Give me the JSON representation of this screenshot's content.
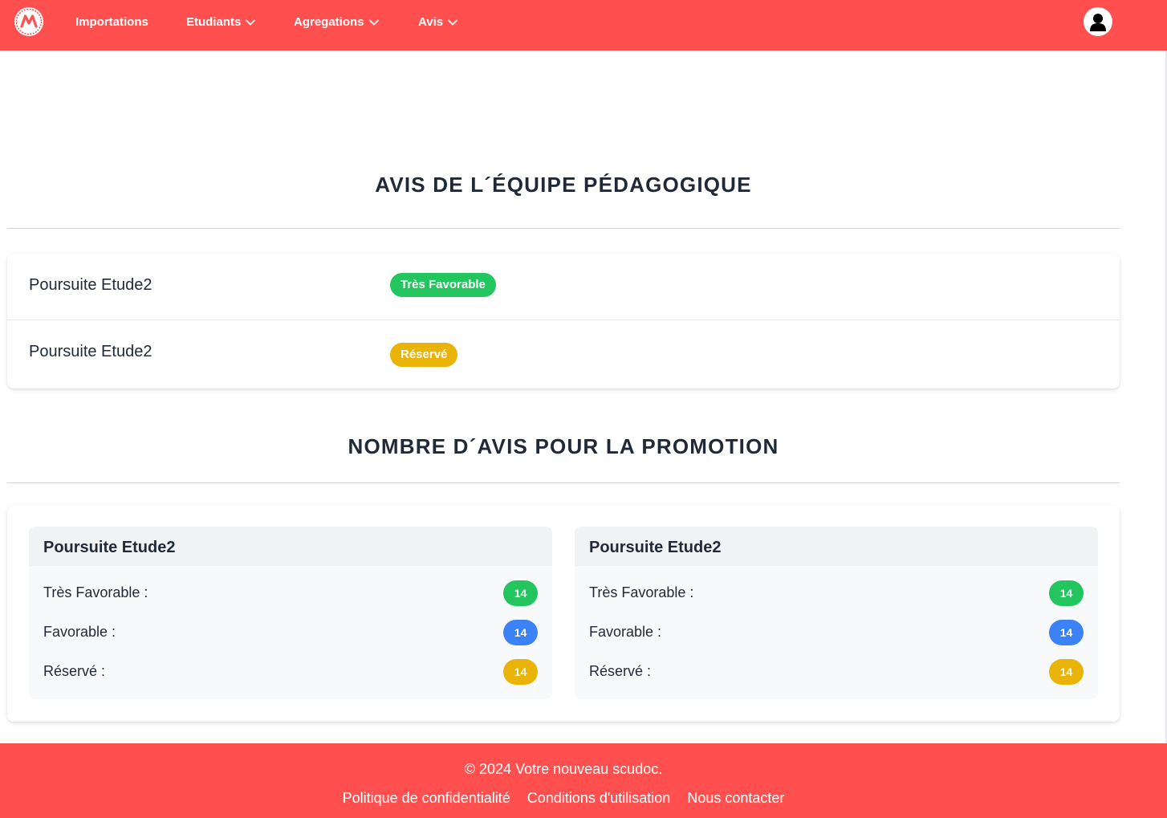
{
  "navbar": {
    "brand_color": "#ff4f4f",
    "logo_icon": "brand-logo-icon",
    "items": [
      {
        "label": "Importations",
        "has_dropdown": false
      },
      {
        "label": "Etudiants",
        "has_dropdown": true
      },
      {
        "label": "Agregations",
        "has_dropdown": true
      },
      {
        "label": "Avis",
        "has_dropdown": true
      }
    ],
    "avatar_icon": "user-avatar-icon"
  },
  "team_section": {
    "title": "AVIS DE L´ÉQUIPE PÉDAGOGIQUE",
    "rows": [
      {
        "label": "Poursuite Etude2",
        "status": "Très Favorable",
        "status_color": "#22c55e"
      },
      {
        "label": "Poursuite Etude2",
        "status": "Réservé",
        "status_color": "#eab308"
      }
    ]
  },
  "promo_section": {
    "title": "NOMBRE D´AVIS POUR LA PROMOTION",
    "panels": [
      {
        "title": "Poursuite Etude2",
        "counts": [
          {
            "label": "Très Favorable :",
            "value": "14",
            "color": "#22c55e"
          },
          {
            "label": "Favorable :",
            "value": "14",
            "color": "#3b82f6"
          },
          {
            "label": "Réservé :",
            "value": "14",
            "color": "#eab308"
          }
        ]
      },
      {
        "title": "Poursuite Etude2",
        "counts": [
          {
            "label": "Très Favorable :",
            "value": "14",
            "color": "#22c55e"
          },
          {
            "label": "Favorable :",
            "value": "14",
            "color": "#3b82f6"
          },
          {
            "label": "Réservé :",
            "value": "14",
            "color": "#eab308"
          }
        ]
      }
    ]
  },
  "footer": {
    "copyright": "© 2024 Votre nouveau scudoc.",
    "links": [
      "Politique de confidentialité",
      "Conditions d'utilisation",
      "Nous contacter"
    ]
  }
}
